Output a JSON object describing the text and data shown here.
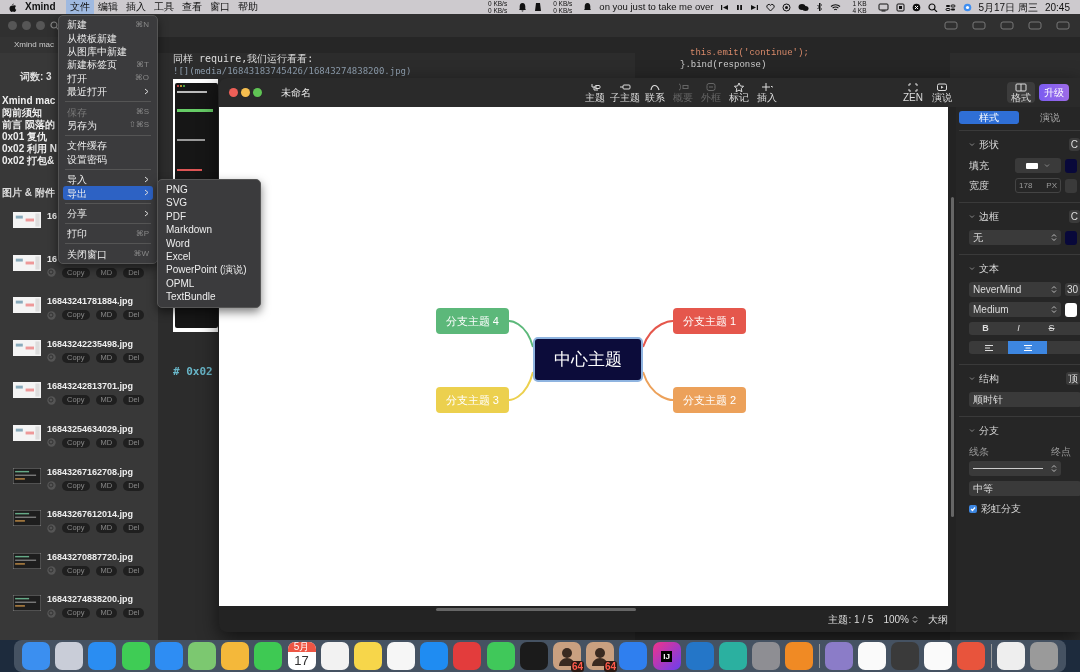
{
  "menu_bar": {
    "app_name": "Xmind",
    "menus": [
      {
        "label": "文件",
        "selected": true
      },
      {
        "label": "编辑",
        "selected": false
      },
      {
        "label": "插入",
        "selected": false
      },
      {
        "label": "工具",
        "selected": false
      },
      {
        "label": "查看",
        "selected": false
      },
      {
        "label": "窗口",
        "selected": false
      },
      {
        "label": "帮助",
        "selected": false
      }
    ],
    "net_left": [
      "0 KB/s",
      "0 KB/s"
    ],
    "net_mid": [
      "0 KB/s",
      "0 KB/s"
    ],
    "now_playing": "on you just to take me over",
    "net_right": [
      "1 KB",
      "4 KB"
    ],
    "date": "5月17日 周三",
    "time": "20:45"
  },
  "editor_app": {
    "tab": "Xmind mac",
    "word_count": "词数: 3",
    "outline": [
      "Xmind mac",
      "阅前须知",
      "前言 陨落的",
      "0x01 复仇",
      "0x02 利用 N",
      "0x02 打包&"
    ],
    "attachments_title": "图片 & 附件",
    "attachments": [
      {
        "name": "16"
      },
      {
        "name": "16",
        "buttons": [
          "Copy",
          "MD",
          "Del"
        ]
      },
      {
        "name": "16843241781884.jpg",
        "buttons": [
          "Copy",
          "MD",
          "Del"
        ]
      },
      {
        "name": "16843242235498.jpg",
        "buttons": [
          "Copy",
          "MD",
          "Del"
        ]
      },
      {
        "name": "16843242813701.jpg",
        "buttons": [
          "Copy",
          "MD",
          "Del"
        ]
      },
      {
        "name": "16843254634029.jpg",
        "buttons": [
          "Copy",
          "MD",
          "Del"
        ]
      },
      {
        "name": "16843267162708.jpg",
        "buttons": [
          "Copy",
          "MD",
          "Del"
        ]
      },
      {
        "name": "16843267612014.jpg",
        "buttons": [
          "Copy",
          "MD",
          "Del"
        ]
      },
      {
        "name": "16843270887720.jpg",
        "buttons": [
          "Copy",
          "MD",
          "Del"
        ]
      },
      {
        "name": "16843274838200.jpg",
        "buttons": [
          "Copy",
          "MD",
          "Del"
        ]
      }
    ],
    "text_line": "同样 require,我们运行看看:",
    "image_link": "![](media/16843183745426/16843274838200.jpg)",
    "heading": "# 0x02",
    "code_lines": [
      "this.emit('continue');",
      "}.bind(response)"
    ]
  },
  "file_menu": [
    {
      "kind": "item",
      "label": "新建",
      "shortcut": "⌘N",
      "disabled": false,
      "selected": false,
      "submenu": false
    },
    {
      "kind": "item",
      "label": "从模板新建",
      "disabled": false,
      "selected": false,
      "submenu": false
    },
    {
      "kind": "item",
      "label": "从图库中新建",
      "disabled": false,
      "selected": false,
      "submenu": false
    },
    {
      "kind": "item",
      "label": "新建标签页",
      "shortcut": "⌘T",
      "disabled": false,
      "selected": false,
      "submenu": false
    },
    {
      "kind": "item",
      "label": "打开",
      "shortcut": "⌘O",
      "disabled": false,
      "selected": false,
      "submenu": false
    },
    {
      "kind": "item",
      "label": "最近打开",
      "disabled": false,
      "selected": false,
      "submenu": true
    },
    {
      "kind": "separator"
    },
    {
      "kind": "item",
      "label": "保存",
      "shortcut": "⌘S",
      "disabled": true,
      "selected": false,
      "submenu": false
    },
    {
      "kind": "item",
      "label": "另存为",
      "shortcut": "⇧⌘S",
      "disabled": false,
      "selected": false,
      "submenu": false
    },
    {
      "kind": "separator"
    },
    {
      "kind": "item",
      "label": "文件缓存",
      "disabled": false,
      "selected": false,
      "submenu": false
    },
    {
      "kind": "item",
      "label": "设置密码",
      "disabled": false,
      "selected": false,
      "submenu": false
    },
    {
      "kind": "separator"
    },
    {
      "kind": "item",
      "label": "导入",
      "disabled": false,
      "selected": false,
      "submenu": true
    },
    {
      "kind": "item",
      "label": "导出",
      "disabled": false,
      "selected": true,
      "submenu": true
    },
    {
      "kind": "separator"
    },
    {
      "kind": "item",
      "label": "分享",
      "disabled": false,
      "selected": false,
      "submenu": true
    },
    {
      "kind": "separator"
    },
    {
      "kind": "item",
      "label": "打印",
      "shortcut": "⌘P",
      "disabled": false,
      "selected": false,
      "submenu": false
    },
    {
      "kind": "separator"
    },
    {
      "kind": "item",
      "label": "关闭窗口",
      "shortcut": "⌘W",
      "disabled": false,
      "selected": false,
      "submenu": false
    }
  ],
  "export_menu": [
    "PNG",
    "SVG",
    "PDF",
    "Markdown",
    "Word",
    "Excel",
    "PowerPoint (演说)",
    "OPML",
    "TextBundle"
  ],
  "xmind": {
    "title": "未命名",
    "toolbar": [
      {
        "kind": "topic",
        "label": "主题",
        "disabled": false
      },
      {
        "kind": "subtopic",
        "label": "子主题",
        "disabled": false
      },
      {
        "kind": "relationship",
        "label": "联系",
        "disabled": false
      },
      {
        "kind": "summary",
        "label": "概要",
        "disabled": true
      },
      {
        "kind": "boundary",
        "label": "外框",
        "disabled": true
      },
      {
        "kind": "marker",
        "label": "标记",
        "disabled": false
      },
      {
        "kind": "insert",
        "label": "插入",
        "disabled": false
      }
    ],
    "view_tools": [
      {
        "kind": "zen",
        "label": "ZEN",
        "selected": false
      },
      {
        "kind": "pitch",
        "label": "演说",
        "selected": false
      },
      {
        "kind": "format",
        "label": "格式",
        "selected": true
      }
    ],
    "upgrade": "升级",
    "central": "中心主题",
    "branches": [
      {
        "label": "分支主题 4",
        "color": "#5cb87a"
      },
      {
        "label": "分支主题 1",
        "color": "#e5574c"
      },
      {
        "label": "分支主题 3",
        "color": "#ecd04e"
      },
      {
        "label": "分支主题 2",
        "color": "#eca15a"
      }
    ],
    "status": {
      "topics": "主题: 1 / 5",
      "zoom": "100%",
      "outline": "大纲"
    },
    "panel": {
      "tabs": [
        {
          "label": "样式",
          "selected": true
        },
        {
          "label": "演说",
          "selected": false
        }
      ],
      "shape": {
        "title": "形状",
        "corner": "C",
        "fill_label": "填充",
        "width_label": "宽度",
        "width_value": "178",
        "width_unit": "PX"
      },
      "border": {
        "title": "边框",
        "corner": "C",
        "value": "无"
      },
      "text": {
        "title": "文本",
        "font": "NeverMind",
        "size": "30",
        "weight": "Medium",
        "styles": [
          "B",
          "I",
          "S"
        ],
        "align": [
          {
            "kind": "left",
            "selected": false
          },
          {
            "kind": "center",
            "selected": true
          }
        ]
      },
      "structure": {
        "title": "结构",
        "corner": "顶",
        "value": "顺时针"
      },
      "branch": {
        "title": "分支",
        "line_label": "线条",
        "end_label": "终点",
        "thickness": "中等",
        "rainbow_label": "彩虹分支",
        "rainbow_checked": true
      }
    }
  },
  "dock": [
    {
      "kind": "app",
      "color": "#3b8ff0"
    },
    {
      "kind": "app",
      "color": "#c9cdd8"
    },
    {
      "kind": "app",
      "color": "#2a8df2"
    },
    {
      "kind": "app",
      "color": "#3fcc55"
    },
    {
      "kind": "app",
      "color": "#2e8df3"
    },
    {
      "kind": "app",
      "color": "#7cc870"
    },
    {
      "kind": "app",
      "color": "#f4b83a"
    },
    {
      "kind": "app",
      "color": "#3ec953"
    },
    {
      "kind": "calendar",
      "month": "5月",
      "day": "17"
    },
    {
      "kind": "app",
      "color": "#f2f2f2"
    },
    {
      "kind": "app",
      "color": "#f7d64a"
    },
    {
      "kind": "app",
      "color": "#f6f6f6"
    },
    {
      "kind": "app",
      "color": "#1f8cf2"
    },
    {
      "kind": "app",
      "color": "#e33c3c"
    },
    {
      "kind": "app",
      "color": "#40c85a"
    },
    {
      "kind": "app",
      "color": "#1b1b1b"
    },
    {
      "kind": "portrait",
      "badge": "64"
    },
    {
      "kind": "portrait",
      "badge": "64"
    },
    {
      "kind": "app",
      "color": "#2f7fef"
    },
    {
      "kind": "lettered",
      "letters": "IJ"
    },
    {
      "kind": "app",
      "color": "#2476c8"
    },
    {
      "kind": "app",
      "color": "#2bb0a0"
    },
    {
      "kind": "app",
      "color": "#8e8e93"
    },
    {
      "kind": "app",
      "color": "#f08a24"
    },
    {
      "kind": "separator"
    },
    {
      "kind": "app",
      "color": "#8b7cc8"
    },
    {
      "kind": "app",
      "color": "#fafafa"
    },
    {
      "kind": "app",
      "color": "#3a3a3a"
    },
    {
      "kind": "app",
      "color": "#fafafa"
    },
    {
      "kind": "app",
      "color": "#e8543c"
    },
    {
      "kind": "separator"
    },
    {
      "kind": "app",
      "color": "#eeeeee"
    },
    {
      "kind": "app",
      "color": "#9a9a9a"
    }
  ]
}
